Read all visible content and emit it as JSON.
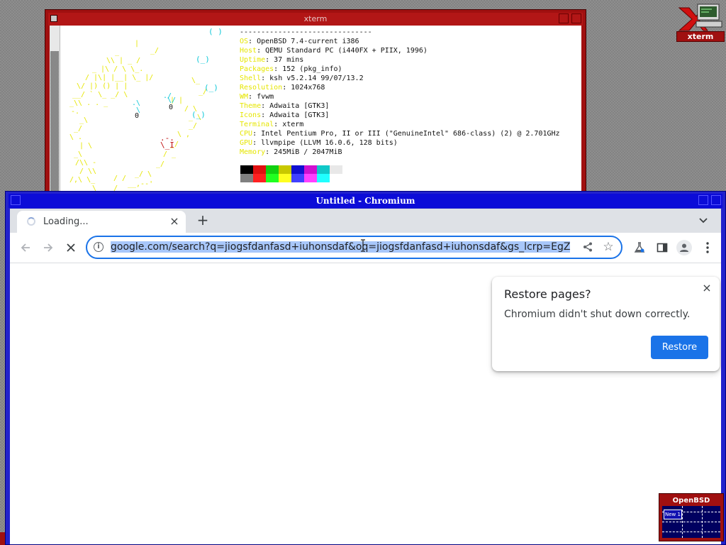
{
  "xterm": {
    "title": "xterm",
    "separator": "-------------------------------",
    "info": [
      {
        "key": "OS",
        "value": ": OpenBSD 7.4-current i386"
      },
      {
        "key": "Host",
        "value": ": QEMU Standard PC (i440FX + PIIX, 1996)"
      },
      {
        "key": "Uptime",
        "value": ": 37 mins"
      },
      {
        "key": "Packages",
        "value": ": 152 (pkg_info)"
      },
      {
        "key": "Shell",
        "value": ": ksh v5.2.14 99/07/13.2"
      },
      {
        "key": "Resolution",
        "value": ": 1024x768"
      },
      {
        "key": "WM",
        "value": ": fvwm"
      },
      {
        "key": "Theme",
        "value": ": Adwaita [GTK3]"
      },
      {
        "key": "Icons",
        "value": ": Adwaita [GTK3]"
      },
      {
        "key": "Terminal",
        "value": ": xterm"
      },
      {
        "key": "CPU",
        "value": ": Intel Pentium Pro, II or III (\"GenuineIntel\" 686-class) (2) @ 2.701GHz"
      },
      {
        "key": "GPU",
        "value": ": llvmpipe (LLVM 16.0.6, 128 bits)"
      },
      {
        "key": "Memory",
        "value": ": 245MiB / 2047MiB"
      }
    ],
    "palette_top": [
      "#000000",
      "#e01010",
      "#10d010",
      "#c8c800",
      "#1010d0",
      "#d010d0",
      "#10c8c8",
      "#e8e8e8"
    ],
    "palette_bottom": [
      "#808080",
      "#ff2020",
      "#20ff20",
      "#ffff20",
      "#4040ff",
      "#ff40ff",
      "#20ffff",
      "#ffffff"
    ]
  },
  "desktop_icon": {
    "label": "xterm"
  },
  "chromium": {
    "window_title": "Untitled - Chromium",
    "tab": {
      "title": "Loading...",
      "close": "×"
    },
    "new_tab": "+",
    "tab_search": "⌄",
    "url": "google.com/search?q=jiogsfdanfasd+iuhonsdaf&oq=jiogsfdanfasd+iuhonsdaf&gs_lcrp=EgZ",
    "restore_bubble": {
      "title": "Restore pages?",
      "message": "Chromium didn't shut down correctly.",
      "button": "Restore",
      "close": "×"
    }
  },
  "pager": {
    "title": "OpenBSD",
    "window_label": "New 1"
  },
  "colors": {
    "xterm_frame": "#a01010",
    "chromium_frame": "#2222cc",
    "accent_blue": "#1a73e8"
  }
}
